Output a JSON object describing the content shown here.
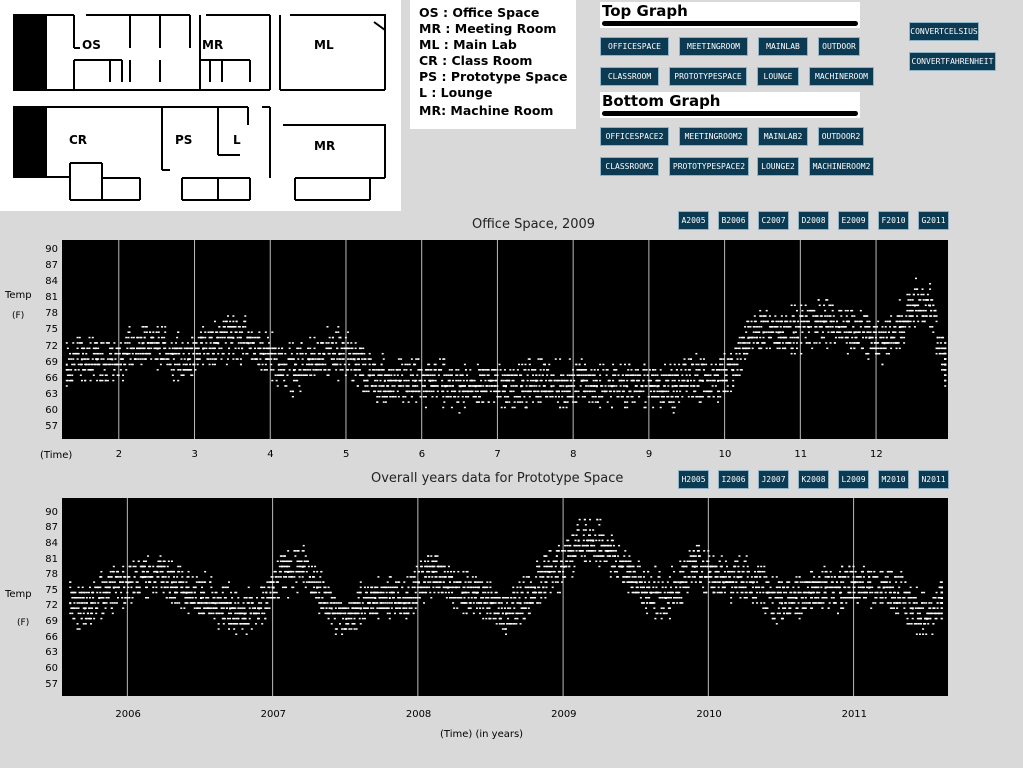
{
  "floorplan": {
    "rooms": [
      "OS",
      "MR",
      "ML",
      "CR",
      "PS",
      "L",
      "MR"
    ]
  },
  "legend": [
    "OS : Office Space",
    "MR : Meeting Room",
    "ML : Main Lab",
    "CR : Class Room",
    "PS : Prototype Space",
    "L : Lounge",
    "MR: Machine Room"
  ],
  "top_section": {
    "title": "Top Graph",
    "buttons_row1": [
      "OFFICESPACE",
      "MEETINGROOM",
      "MAINLAB",
      "OUTDOOR"
    ],
    "buttons_row2": [
      "CLASSROOM",
      "PROTOTYPESPACE",
      "LOUNGE",
      "MACHINEROOM"
    ]
  },
  "bottom_section": {
    "title": "Bottom Graph",
    "buttons_row1": [
      "OFFICESPACE2",
      "MEETINGROOM2",
      "MAINLAB2",
      "OUTDOOR2"
    ],
    "buttons_row2": [
      "CLASSROOM2",
      "PROTOTYPESPACE2",
      "LOUNGE2",
      "MACHINEROOM2"
    ]
  },
  "convert_buttons": [
    "CONVERTCELSIUS",
    "CONVERTFAHRENHEIT"
  ],
  "top_year_buttons": [
    "A2005",
    "B2006",
    "C2007",
    "D2008",
    "E2009",
    "F2010",
    "G2011"
  ],
  "bottom_year_buttons": [
    "H2005",
    "I2006",
    "J2007",
    "K2008",
    "L2009",
    "M2010",
    "N2011"
  ],
  "colors": {
    "button_bg": "#0b3a52",
    "plot_bg": "#000000",
    "points": "#ffffff"
  },
  "chart_data": [
    {
      "type": "scatter",
      "title": "Office Space, 2009",
      "ylabel": "Temp",
      "yunit": "(F)",
      "xlabel": "(Time)",
      "y_ticks": [
        90,
        87,
        84,
        81,
        78,
        75,
        72,
        69,
        66,
        63,
        60,
        57
      ],
      "x_ticks": [
        "2",
        "3",
        "4",
        "5",
        "6",
        "7",
        "8",
        "9",
        "10",
        "11",
        "12"
      ],
      "xlim": [
        1.25,
        12.95
      ],
      "ylim": [
        55,
        92
      ],
      "grid": "vertical month dividers",
      "series": [
        {
          "x": [
            1.3,
            1.5,
            1.7,
            1.9,
            2.1,
            2.3,
            2.5,
            2.7,
            2.9,
            3.1,
            3.3,
            3.5,
            3.7,
            3.9,
            4.1,
            4.3,
            4.5,
            4.7,
            4.9,
            5.1,
            5.3,
            5.5,
            5.7,
            5.9,
            6.1,
            6.3,
            6.5,
            6.7,
            6.9,
            7.1,
            7.3,
            7.5,
            7.7,
            7.9,
            8.1,
            8.3,
            8.5,
            8.7,
            8.9,
            9.1,
            9.3,
            9.5,
            9.7,
            9.9,
            10.1,
            10.3,
            10.5,
            10.7,
            10.9,
            11.1,
            11.3,
            11.5,
            11.7,
            11.9,
            12.1,
            12.3,
            12.5,
            12.7,
            12.9
          ],
          "y": [
            69,
            70,
            70,
            70,
            71,
            73,
            72,
            71,
            70,
            72,
            73,
            74,
            73,
            71,
            69,
            68,
            70,
            71,
            71,
            70,
            67,
            66,
            66,
            66,
            66,
            65,
            65,
            65,
            66,
            65,
            65,
            66,
            65,
            65,
            66,
            65,
            65,
            65,
            65,
            65,
            65,
            66,
            66,
            66,
            68,
            74,
            75,
            75,
            75,
            76,
            77,
            76,
            75,
            74,
            73,
            76,
            80,
            80,
            69
          ]
        }
      ]
    },
    {
      "type": "scatter",
      "title": "Overall years data for Prototype Space",
      "ylabel": "Temp",
      "yunit": "(F)",
      "xlabel": "(Time)   (in years)",
      "y_ticks": [
        90,
        87,
        84,
        81,
        78,
        75,
        72,
        69,
        66,
        63,
        60,
        57
      ],
      "x_ticks": [
        "2006",
        "2007",
        "2008",
        "2009",
        "2010",
        "2011"
      ],
      "xlim": [
        2005.55,
        2011.65
      ],
      "ylim": [
        55,
        93
      ],
      "grid": "vertical year dividers",
      "series": [
        {
          "x": [
            2005.6,
            2005.7,
            2005.8,
            2005.9,
            2006.0,
            2006.1,
            2006.2,
            2006.3,
            2006.4,
            2006.5,
            2006.6,
            2006.7,
            2006.8,
            2006.9,
            2007.0,
            2007.1,
            2007.2,
            2007.3,
            2007.4,
            2007.5,
            2007.6,
            2007.7,
            2007.8,
            2007.9,
            2008.0,
            2008.1,
            2008.2,
            2008.3,
            2008.4,
            2008.5,
            2008.6,
            2008.7,
            2008.8,
            2008.9,
            2009.0,
            2009.1,
            2009.2,
            2009.3,
            2009.4,
            2009.5,
            2009.6,
            2009.7,
            2009.8,
            2009.9,
            2010.0,
            2010.1,
            2010.2,
            2010.3,
            2010.4,
            2010.5,
            2010.6,
            2010.7,
            2010.8,
            2010.9,
            2011.0,
            2011.1,
            2011.2,
            2011.3,
            2011.4,
            2011.5,
            2011.6
          ],
          "y": [
            73,
            72,
            74,
            76,
            77,
            78,
            79,
            77,
            75,
            74,
            73,
            72,
            71,
            72,
            76,
            79,
            80,
            76,
            72,
            70,
            72,
            74,
            74,
            73,
            77,
            79,
            76,
            75,
            75,
            73,
            71,
            73,
            76,
            79,
            80,
            85,
            85,
            83,
            80,
            77,
            75,
            74,
            77,
            80,
            79,
            77,
            78,
            77,
            75,
            73,
            74,
            75,
            76,
            75,
            77,
            76,
            76,
            75,
            72,
            70,
            74
          ]
        }
      ]
    }
  ]
}
